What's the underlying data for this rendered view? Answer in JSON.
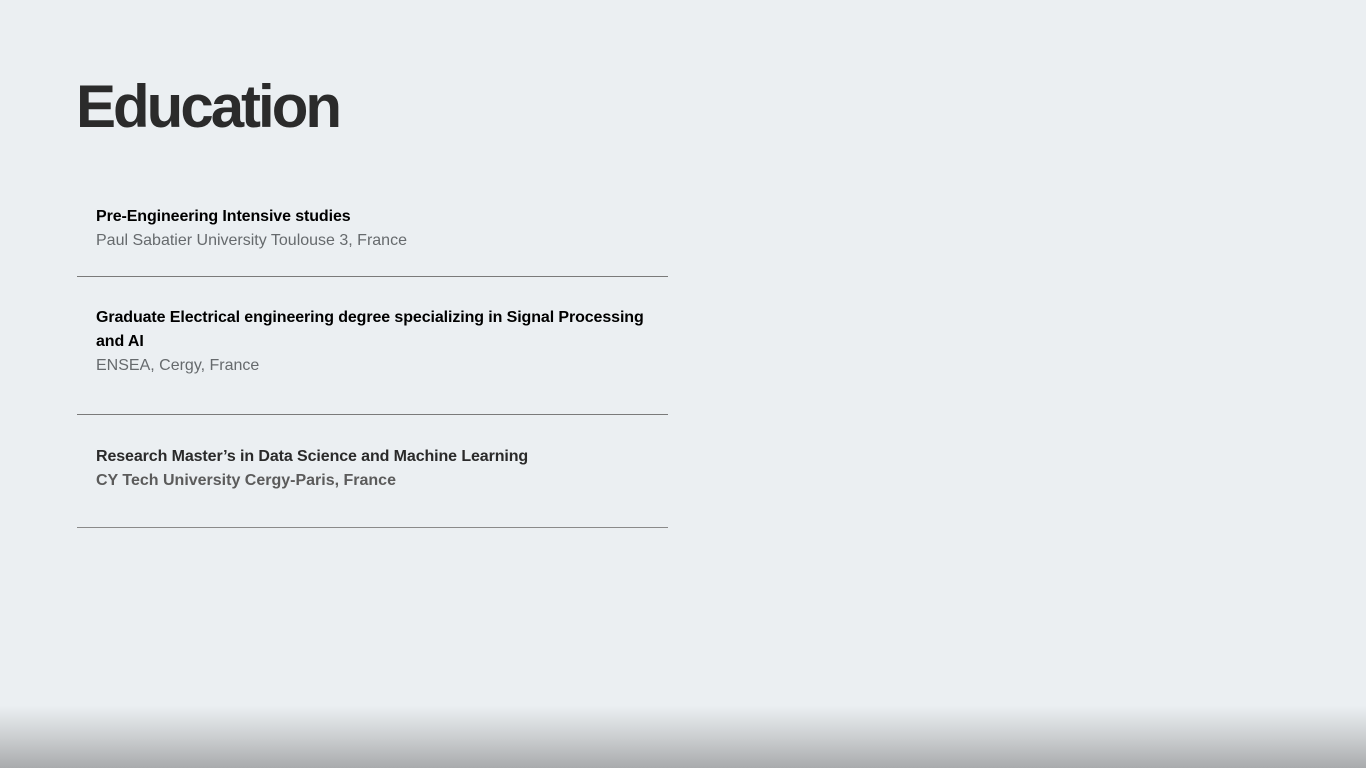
{
  "page": {
    "title": "Education"
  },
  "education": {
    "items": [
      {
        "degree": "Pre-Engineering Intensive studies",
        "school": "Paul Sabatier University Toulouse 3, France"
      },
      {
        "degree": "Graduate Electrical engineering degree specializing in Signal Processing and AI",
        "school": "ENSEA, Cergy, France"
      },
      {
        "degree": "Research Master’s in Data Science and Machine Learning",
        "school": "CY Tech University Cergy-Paris, France"
      }
    ]
  },
  "colors": {
    "background": "#ebeff2",
    "title": "#2b2b2b",
    "school_text": "#666a6d",
    "divider": "#7a7a7a"
  }
}
